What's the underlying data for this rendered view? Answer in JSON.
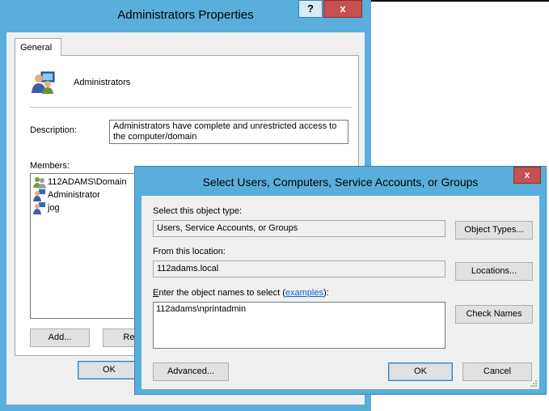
{
  "properties_window": {
    "title": "Administrators Properties",
    "help_glyph": "?",
    "close_glyph": "x",
    "tab": "General",
    "group_name": "Administrators",
    "description_label": "Description:",
    "description_value": "Administrators have complete and unrestricted access to the computer/domain",
    "members_label": "Members:",
    "members": [
      {
        "name": "112ADAMS\\Domain",
        "icon": "group-icon"
      },
      {
        "name": "Administrator",
        "icon": "user-icon"
      },
      {
        "name": "jog",
        "icon": "user-icon"
      }
    ],
    "add_button": "Add...",
    "remove_button": "Rem",
    "ok_button": "OK"
  },
  "select_dialog": {
    "title": "Select Users, Computers, Service Accounts, or Groups",
    "close_glyph": "x",
    "object_type_label": "Select this object type:",
    "object_type_value": "Users, Service Accounts, or Groups",
    "object_types_button": "Object Types...",
    "location_label": "From this location:",
    "location_value": "112adams.local",
    "locations_button": "Locations...",
    "names_label_first": "E",
    "names_label_rest": "nter the object names to select (",
    "names_label_link": "examples",
    "names_label_end": "):",
    "names_value": "112adams\\nprintadmin",
    "check_names_button": "Check Names",
    "advanced_button": "Advanced...",
    "ok_button": "OK",
    "cancel_button": "Cancel"
  },
  "colors": {
    "title_bar": "#5aaedb",
    "close_button": "#c75050",
    "link": "#0066cc"
  }
}
